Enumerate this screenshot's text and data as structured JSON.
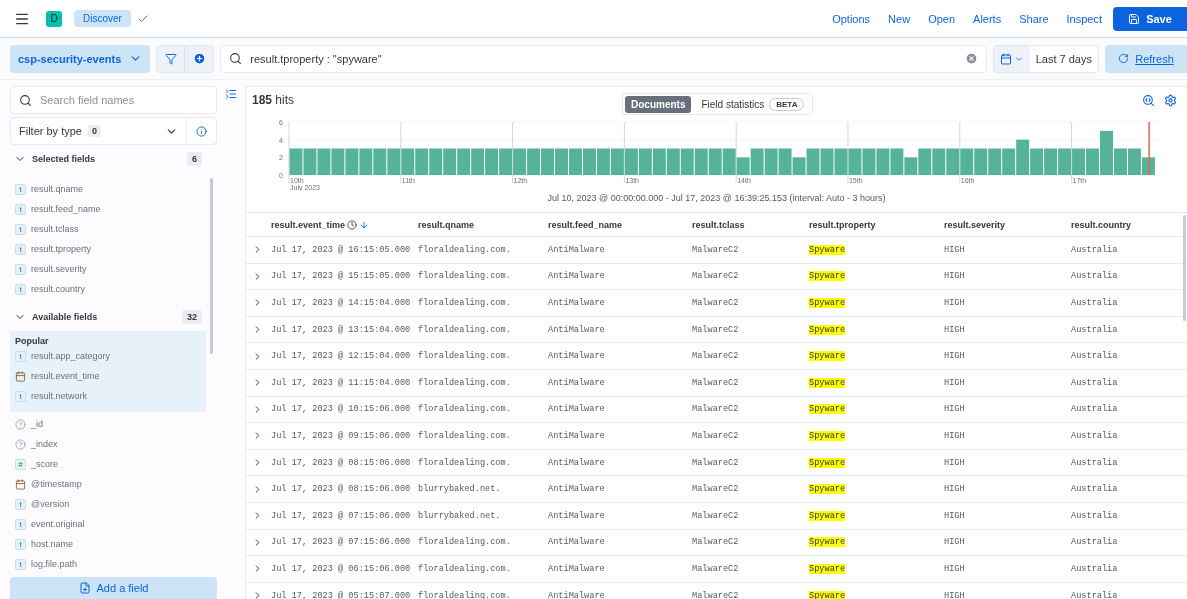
{
  "header": {
    "space_initial": "D",
    "breadcrumb": "Discover",
    "links": [
      "Options",
      "New",
      "Open",
      "Alerts",
      "Share",
      "Inspect"
    ],
    "save": "Save"
  },
  "query_bar": {
    "data_view": "csp-security-events",
    "query": "result.tproperty : \"spyware\"",
    "date_range": "Last 7 days",
    "refresh": "Refresh"
  },
  "sidebar": {
    "search_placeholder": "Search field names",
    "filter_label": "Filter by type",
    "filter_count": "0",
    "selected": {
      "title": "Selected fields",
      "count": "6",
      "expanded": true,
      "fields": [
        {
          "kind": "string",
          "token": "t",
          "name": "result.qname"
        },
        {
          "kind": "string",
          "token": "t",
          "name": "result.feed_name"
        },
        {
          "kind": "string",
          "token": "t",
          "name": "result.tclass"
        },
        {
          "kind": "string",
          "token": "t",
          "name": "result.tproperty"
        },
        {
          "kind": "string",
          "token": "t",
          "name": "result.severity"
        },
        {
          "kind": "string",
          "token": "t",
          "name": "result.country"
        }
      ]
    },
    "available": {
      "title": "Available fields",
      "count": "32",
      "expanded": true,
      "popular_title": "Popular",
      "popular": [
        {
          "kind": "string",
          "token": "t",
          "name": "result.app_category"
        },
        {
          "kind": "date",
          "name": "result.event_time"
        },
        {
          "kind": "string",
          "token": "t",
          "name": "result.network"
        }
      ],
      "fields": [
        {
          "kind": "unknown",
          "name": "_id"
        },
        {
          "kind": "unknown",
          "name": "_index"
        },
        {
          "kind": "number",
          "token": "#",
          "name": "_score"
        },
        {
          "kind": "date",
          "name": "@timestamp"
        },
        {
          "kind": "string",
          "token": "t",
          "name": "@version"
        },
        {
          "kind": "string",
          "token": "t",
          "name": "event.original"
        },
        {
          "kind": "string",
          "token": "t",
          "name": "host.name"
        },
        {
          "kind": "string",
          "token": "t",
          "name": "log.file.path"
        }
      ]
    },
    "add_field": "Add a field"
  },
  "results": {
    "hits": "**185** hits",
    "tabs": [
      {
        "label": "Documents",
        "selected": true
      },
      {
        "label": "Field statistics",
        "selected": false,
        "badge": "BETA"
      }
    ],
    "histogram": {
      "year_label": "July 2023",
      "caption": "Jul 10, 2023 @ 00:00:00.000 - Jul 17, 2023 @ 16:39:25.153 (interval: Auto - 3 hours)",
      "chart_data": {
        "type": "bar",
        "categories": [
          "10th",
          null,
          null,
          null,
          null,
          null,
          null,
          null,
          "11th",
          null,
          null,
          null,
          null,
          null,
          null,
          null,
          "12th",
          null,
          null,
          null,
          null,
          null,
          null,
          null,
          "13th",
          null,
          null,
          null,
          null,
          null,
          null,
          null,
          "14th",
          null,
          null,
          null,
          null,
          null,
          null,
          null,
          "15th",
          null,
          null,
          null,
          null,
          null,
          null,
          null,
          "16th",
          null,
          null,
          null,
          null,
          null,
          null,
          null,
          "17th",
          null,
          null,
          null,
          null,
          null
        ],
        "values": [
          3,
          3,
          3,
          3,
          3,
          3,
          3,
          3,
          3,
          3,
          3,
          3,
          3,
          3,
          3,
          3,
          3,
          3,
          3,
          3,
          3,
          3,
          3,
          3,
          3,
          3,
          3,
          3,
          3,
          3,
          3,
          3,
          2,
          3,
          3,
          3,
          2,
          3,
          3,
          3,
          3,
          3,
          3,
          3,
          2,
          3,
          3,
          3,
          3,
          3,
          3,
          3,
          4,
          3,
          3,
          3,
          3,
          3,
          5,
          3,
          3,
          2
        ],
        "ylim": [
          0,
          6
        ],
        "yticks": [
          0,
          2,
          4,
          6
        ]
      },
      "now_marker": true
    },
    "table": {
      "columns": [
        {
          "label": "result.event_time",
          "sorted": true,
          "highlight": false
        },
        {
          "label": "result.qname",
          "sorted": false,
          "highlight": false
        },
        {
          "label": "result.feed_name",
          "sorted": false,
          "highlight": false
        },
        {
          "label": "result.tclass",
          "sorted": false,
          "highlight": false
        },
        {
          "label": "result.tproperty",
          "sorted": false,
          "highlight": true
        },
        {
          "label": "result.severity",
          "sorted": false,
          "highlight": false
        },
        {
          "label": "result.country",
          "sorted": false,
          "highlight": false
        }
      ],
      "rows": [
        [
          "Jul 17, 2023 @ 16:15:05.000",
          "floraldealing.com.",
          "AntiMalware",
          "MalwareC2",
          "Spyware",
          "HIGH",
          "Australia"
        ],
        [
          "Jul 17, 2023 @ 15:15:05.000",
          "floraldealing.com.",
          "AntiMalware",
          "MalwareC2",
          "Spyware",
          "HIGH",
          "Australia"
        ],
        [
          "Jul 17, 2023 @ 14:15:04.000",
          "floraldealing.com.",
          "AntiMalware",
          "MalwareC2",
          "Spyware",
          "HIGH",
          "Australia"
        ],
        [
          "Jul 17, 2023 @ 13:15:04.000",
          "floraldealing.com.",
          "AntiMalware",
          "MalwareC2",
          "Spyware",
          "HIGH",
          "Australia"
        ],
        [
          "Jul 17, 2023 @ 12:15:04.000",
          "floraldealing.com.",
          "AntiMalware",
          "MalwareC2",
          "Spyware",
          "HIGH",
          "Australia"
        ],
        [
          "Jul 17, 2023 @ 11:15:04.000",
          "floraldealing.com.",
          "AntiMalware",
          "MalwareC2",
          "Spyware",
          "HIGH",
          "Australia"
        ],
        [
          "Jul 17, 2023 @ 10:15:06.000",
          "floraldealing.com.",
          "AntiMalware",
          "MalwareC2",
          "Spyware",
          "HIGH",
          "Australia"
        ],
        [
          "Jul 17, 2023 @ 09:15:06.000",
          "floraldealing.com.",
          "AntiMalware",
          "MalwareC2",
          "Spyware",
          "HIGH",
          "Australia"
        ],
        [
          "Jul 17, 2023 @ 08:15:06.000",
          "floraldealing.com.",
          "AntiMalware",
          "MalwareC2",
          "Spyware",
          "HIGH",
          "Australia"
        ],
        [
          "Jul 17, 2023 @ 08:15:06.000",
          "blurrybaked.net.",
          "AntiMalware",
          "MalwareC2",
          "Spyware",
          "HIGH",
          "Australia"
        ],
        [
          "Jul 17, 2023 @ 07:15:06.000",
          "blurrybaked.net.",
          "AntiMalware",
          "MalwareC2",
          "Spyware",
          "HIGH",
          "Australia"
        ],
        [
          "Jul 17, 2023 @ 07:15:06.000",
          "floraldealing.com.",
          "AntiMalware",
          "MalwareC2",
          "Spyware",
          "HIGH",
          "Australia"
        ],
        [
          "Jul 17, 2023 @ 06:15:06.000",
          "floraldealing.com.",
          "AntiMalware",
          "MalwareC2",
          "Spyware",
          "HIGH",
          "Australia"
        ],
        [
          "Jul 17, 2023 @ 05:15:07.000",
          "floraldealing.com.",
          "AntiMalware",
          "MalwareC2",
          "Spyware",
          "HIGH",
          "Australia"
        ]
      ]
    }
  }
}
